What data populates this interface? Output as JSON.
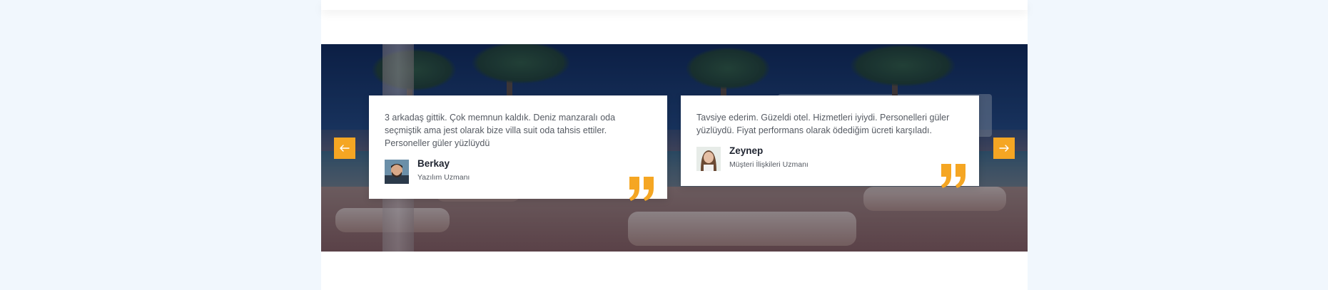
{
  "colors": {
    "page_background": "#f1f7fd",
    "accent": "#f5a623",
    "card_background": "#ffffff",
    "name_text": "#1f2430",
    "body_text": "#555a62"
  },
  "hero": {
    "background_image": "pool-resort-photo"
  },
  "slider": {
    "prev_icon": "arrow-left-icon",
    "next_icon": "arrow-right-icon"
  },
  "testimonials": [
    {
      "text": "3 arkadaş gittik. Çok memnun kaldık. Deniz manzaralı oda seçmiştik ama jest olarak bize villa suit oda tahsis ettiler. Personeller güler yüzlüydü",
      "name": "Berkay",
      "role": "Yazılım Uzmanı",
      "avatar_icon": "male-avatar",
      "quote_icon": "quote-icon"
    },
    {
      "text": "Tavsiye ederim. Güzeldi otel. Hizmetleri iyiydi. Personelleri güler yüzlüydü. Fiyat performans olarak ödediğim ücreti karşıladı.",
      "name": "Zeynep",
      "role": "Müşteri İlişkileri Uzmanı",
      "avatar_icon": "female-avatar",
      "quote_icon": "quote-icon"
    }
  ]
}
